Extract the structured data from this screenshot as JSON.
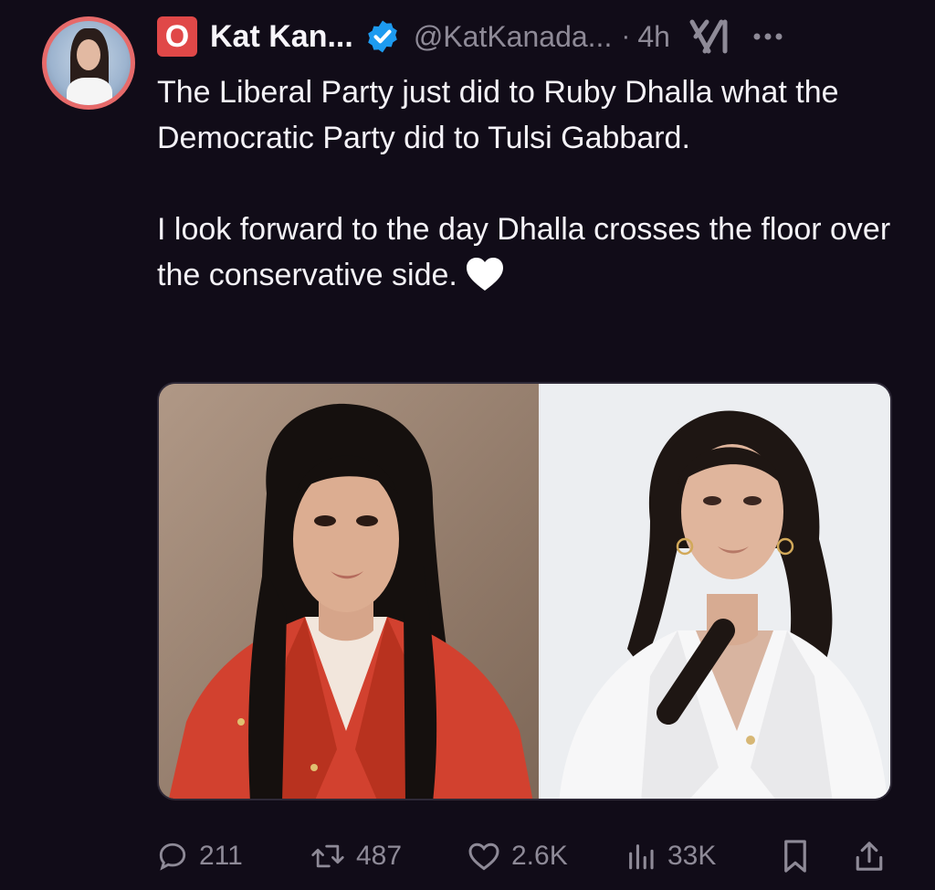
{
  "author": {
    "badge_letter": "O",
    "display_name": "Kat Kan...",
    "handle": "@KatKanada...",
    "separator": "·",
    "timestamp": "4h",
    "verified_color": "#1d9bf0",
    "badge_color": "#e04848"
  },
  "tweet": {
    "paragraph_1": "The Liberal Party just did to Ruby Dhalla what the Democratic Party did to Tulsi Gabbard.",
    "paragraph_2": "I look forward to the day Dhalla crosses the floor over the conservative side."
  },
  "media": {
    "left_photo": "woman-in-red-blazer",
    "right_photo": "woman-in-white-blazer"
  },
  "actions": {
    "replies": "211",
    "reposts": "487",
    "likes": "2.6K",
    "views": "33K"
  },
  "icons": {
    "reply": "speech-bubble-icon",
    "repost": "repost-arrows-icon",
    "like": "heart-outline-icon",
    "views": "bar-chart-icon",
    "bookmark": "bookmark-icon",
    "share": "share-upload-icon",
    "more": "ellipsis-icon",
    "grok": "grok-logo-icon"
  },
  "colors": {
    "background": "#110c18",
    "text": "#f4f2f7",
    "muted": "#8e8a97"
  }
}
